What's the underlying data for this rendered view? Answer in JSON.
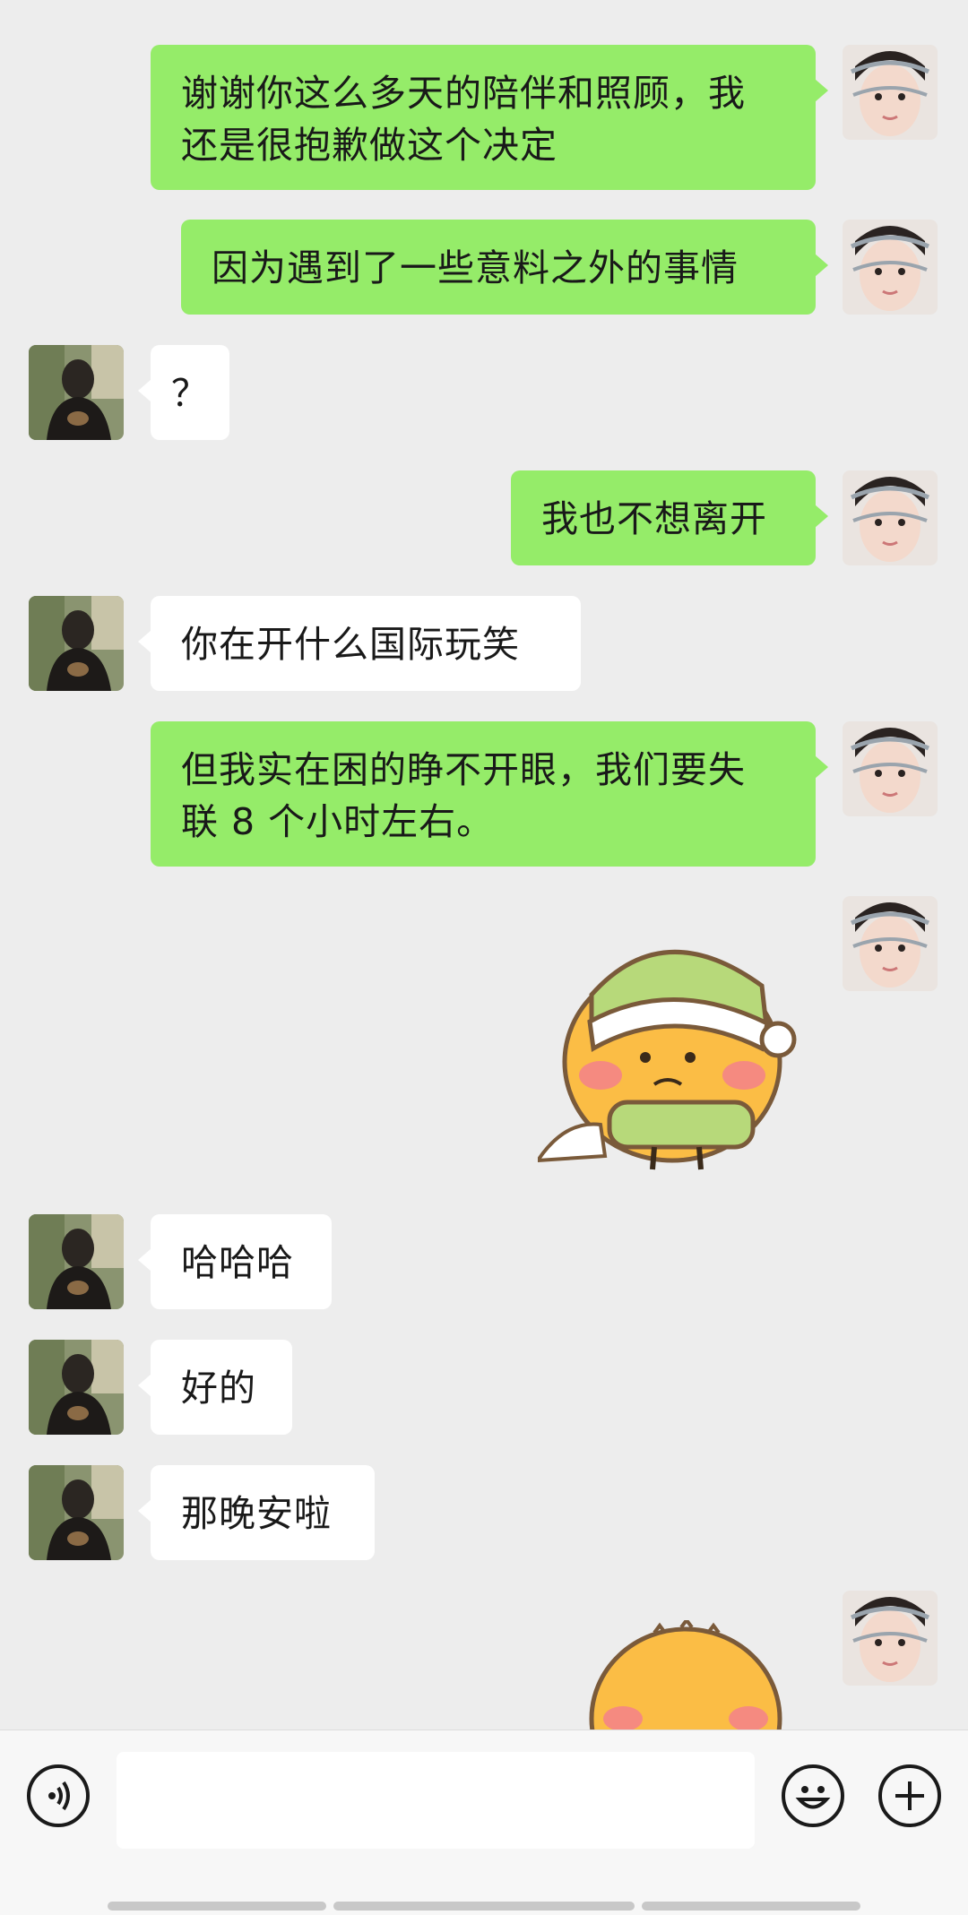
{
  "chat": {
    "messages": [
      {
        "sender": "me",
        "type": "text",
        "text": "谢谢你这么多天的陪伴和照顾，我\n还是很抱歉做这个决定"
      },
      {
        "sender": "me",
        "type": "text",
        "text": "因为遇到了一些意料之外的事情"
      },
      {
        "sender": "them",
        "type": "text",
        "text": "？"
      },
      {
        "sender": "me",
        "type": "text",
        "text": "我也不想离开"
      },
      {
        "sender": "them",
        "type": "text",
        "text": "你在开什么国际玩笑"
      },
      {
        "sender": "me",
        "type": "text",
        "text": "但我实在困的睁不开眼，我们要失\n联 8 个小时左右。"
      },
      {
        "sender": "me",
        "type": "sticker",
        "sticker": "sleepy-bun-sticker"
      },
      {
        "sender": "them",
        "type": "text",
        "text": "哈哈哈"
      },
      {
        "sender": "them",
        "type": "text",
        "text": "好的"
      },
      {
        "sender": "them",
        "type": "text",
        "text": "那晚安啦"
      },
      {
        "sender": "me",
        "type": "sticker",
        "sticker": "bun-sticker"
      }
    ]
  },
  "colors": {
    "background": "#ededed",
    "my_bubble": "#95ec69",
    "their_bubble": "#ffffff",
    "text": "#191919"
  },
  "input_bar": {
    "voice_icon": "voice-icon",
    "emoji_icon": "emoji-icon",
    "plus_icon": "plus-icon",
    "text_value": ""
  }
}
